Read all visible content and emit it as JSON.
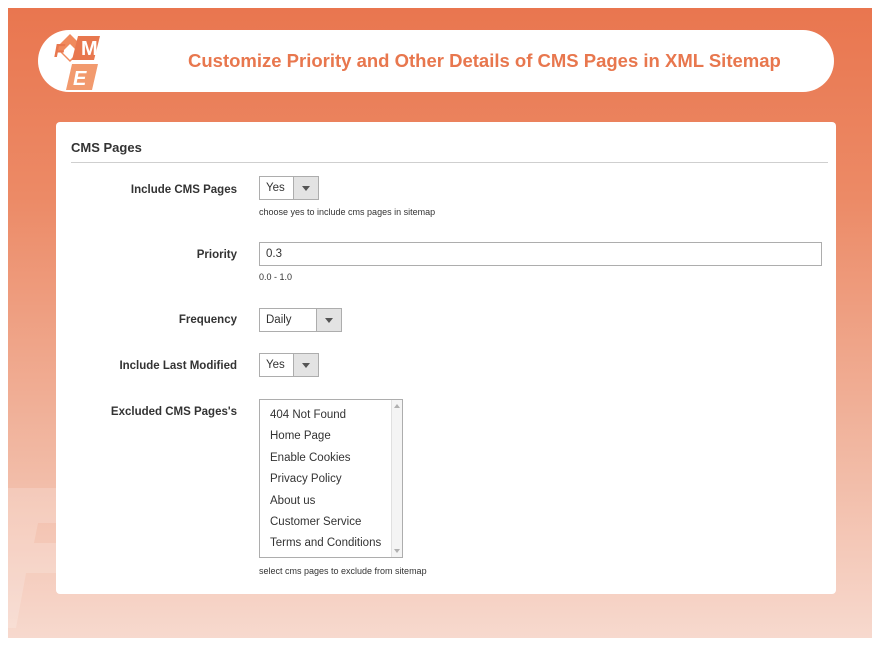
{
  "header": {
    "title": "Customize Priority and Other Details of CMS Pages in XML Sitemap",
    "logo_text": "FME"
  },
  "section": {
    "title": "CMS Pages"
  },
  "fields": {
    "include_cms_pages": {
      "label": "Include CMS Pages",
      "value": "Yes",
      "note": "choose yes to include cms pages in sitemap"
    },
    "priority": {
      "label": "Priority",
      "value": "0.3",
      "note": "0.0 - 1.0"
    },
    "frequency": {
      "label": "Frequency",
      "value": "Daily"
    },
    "include_last_modified": {
      "label": "Include Last Modified",
      "value": "Yes"
    },
    "excluded_cms_pages": {
      "label": "Excluded CMS Pages's",
      "options": [
        "404 Not Found",
        "Home Page",
        "Enable Cookies",
        "Privacy Policy",
        "About us",
        "Customer Service",
        "Terms and Conditions"
      ],
      "note": "select cms pages to exclude from sitemap"
    }
  },
  "colors": {
    "accent": "#e8774e",
    "background_top": "#e9764f",
    "background_bottom": "#f7d9ce"
  },
  "icons": {
    "dropdown": "chevron-down-icon"
  }
}
